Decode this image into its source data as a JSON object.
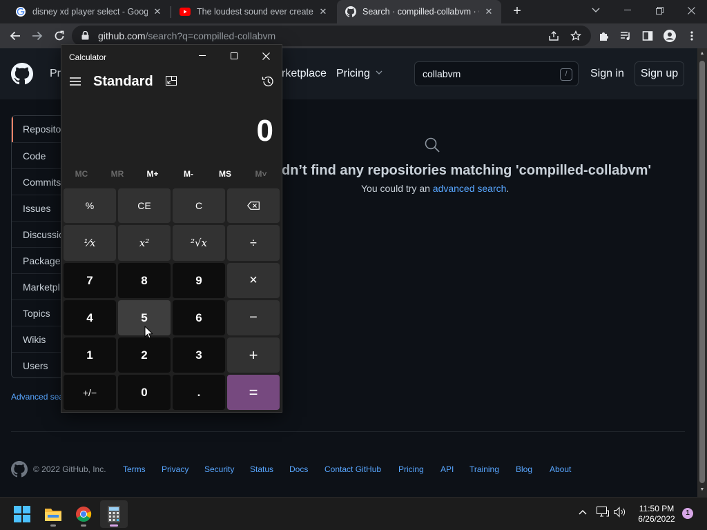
{
  "browser": {
    "tabs": [
      {
        "title": "disney xd player select - Google",
        "close": "✕"
      },
      {
        "title": "The loudest sound ever created...",
        "close": "✕"
      },
      {
        "title": "Search · compilled-collabvm · Git",
        "close": "✕"
      }
    ],
    "new_tab": "+",
    "url_host": "github.com",
    "url_path": "/search?q=compilled-collabvm"
  },
  "github": {
    "nav": {
      "product_partial": "Pr",
      "marketplace": "rketplace",
      "pricing": "Pricing"
    },
    "search_value": "collabvm",
    "search_shortcut": "/",
    "sign_in": "Sign in",
    "sign_up": "Sign up",
    "sidebar": [
      {
        "label": "Reposito"
      },
      {
        "label": "Code"
      },
      {
        "label": "Commits"
      },
      {
        "label": "Issues"
      },
      {
        "label": "Discussio"
      },
      {
        "label": "Packages"
      },
      {
        "label": "Marketpl"
      },
      {
        "label": "Topics"
      },
      {
        "label": "Wikis"
      },
      {
        "label": "Users"
      }
    ],
    "advanced_search_partial": "Advanced sea",
    "empty_title": "dn’t find any repositories matching 'compilled-collabvm'",
    "empty_sub_prefix": "You could try an ",
    "empty_sub_link": "advanced search",
    "empty_sub_suffix": ".",
    "footer": {
      "copyright": "© 2022 GitHub, Inc.",
      "links": [
        "Terms",
        "Privacy",
        "Security",
        "Status",
        "Docs",
        "Contact GitHub",
        "Pricing",
        "API",
        "Training",
        "Blog",
        "About"
      ]
    }
  },
  "calculator": {
    "title": "Calculator",
    "mode": "Standard",
    "display": "0",
    "memory": [
      "MC",
      "MR",
      "M+",
      "M-",
      "MS",
      "M˅"
    ],
    "keys": [
      [
        "%",
        "CE",
        "C",
        "⌫"
      ],
      [
        "¹⁄x",
        "x²",
        "²√x",
        "÷"
      ],
      [
        "7",
        "8",
        "9",
        "×"
      ],
      [
        "4",
        "5",
        "6",
        "−"
      ],
      [
        "1",
        "2",
        "3",
        "+"
      ],
      [
        "+/−",
        "0",
        ".",
        "="
      ]
    ]
  },
  "taskbar": {
    "time": "11:50 PM",
    "date": "6/26/2022",
    "notifications": "1"
  }
}
